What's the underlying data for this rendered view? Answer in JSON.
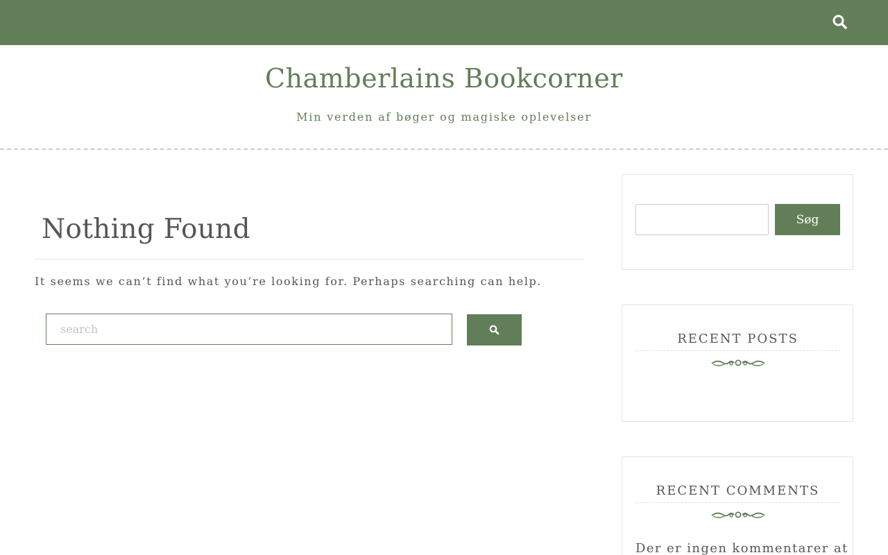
{
  "topbar": {
    "search_icon": "search-icon",
    "accent": "#627e59"
  },
  "header": {
    "site_title": "Chamberlains Bookcorner",
    "tagline": "Min verden af bøger og magiske oplevelser"
  },
  "main": {
    "title": "Nothing Found",
    "message": "It seems we can’t find what you’re looking for. Perhaps searching can help.",
    "search": {
      "placeholder": "search",
      "value": "",
      "button_icon": "search-icon"
    }
  },
  "sidebar": {
    "search_widget": {
      "input_value": "",
      "button_label": "Søg"
    },
    "recent_posts": {
      "title": "RECENT POSTS",
      "divider_icon": "flourish-ornament"
    },
    "recent_comments": {
      "title": "RECENT COMMENTS",
      "divider_icon": "flourish-ornament",
      "empty_text": "Der er ingen kommentarer at"
    }
  },
  "colors": {
    "brand_green": "#627e59",
    "text_gray": "#555555",
    "border_light": "#e4e4e4"
  }
}
